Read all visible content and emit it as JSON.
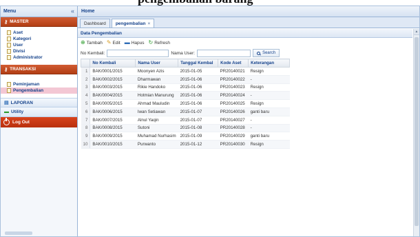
{
  "caption": "pengembalian barang",
  "sidebar": {
    "title": "Menu",
    "collapse_glyph": "«",
    "master": {
      "label": "MASTER",
      "icon": "key-icon"
    },
    "master_items": [
      {
        "label": "Aset"
      },
      {
        "label": "Kategori"
      },
      {
        "label": "User"
      },
      {
        "label": "Divisi"
      },
      {
        "label": "Administrator"
      }
    ],
    "transaksi": {
      "label": "TRANSAKSI",
      "icon": "key-icon"
    },
    "transaksi_items": [
      {
        "label": "Peminjaman"
      },
      {
        "label": "Pengembalian",
        "selected": true
      }
    ],
    "laporan": {
      "label": "LAPORAN"
    },
    "utility": {
      "label": "Utility"
    },
    "logout": {
      "label": "Log Out"
    }
  },
  "main": {
    "title": "Home",
    "tabs": [
      {
        "label": "Dashboard",
        "active": false
      },
      {
        "label": "pengembalian",
        "active": true,
        "close": "×"
      }
    ],
    "grid_title": "Data Pengembalian",
    "toolbar": {
      "add": "Tambah",
      "edit": "Edit",
      "delete": "Hapus",
      "refresh": "Refresh"
    },
    "search": {
      "no_kembali_label": "No Kembali:",
      "no_kembali_value": "",
      "nama_user_label": "Nama User:",
      "nama_user_value": "",
      "button": "Search"
    },
    "columns": [
      "No Kembali",
      "Nama User",
      "Tanggal Kembal",
      "Kode Aset",
      "Keterangan"
    ],
    "rows": [
      {
        "no": "1",
        "no_kembali": "BAK/0001/2015",
        "nama_user": "Moonyen Azis",
        "tanggal": "2015-01-05",
        "kode_aset": "PR20140021",
        "keterangan": "Resign"
      },
      {
        "no": "2",
        "no_kembali": "BAK/0002/2015",
        "nama_user": "Dharmawan",
        "tanggal": "2015-01-06",
        "kode_aset": "PR20140022",
        "keterangan": "-"
      },
      {
        "no": "3",
        "no_kembali": "BAK/0003/2015",
        "nama_user": "Rikie Handoko",
        "tanggal": "2015-01-06",
        "kode_aset": "PR20140023",
        "keterangan": "Resign"
      },
      {
        "no": "4",
        "no_kembali": "BAK/0004/2015",
        "nama_user": "Hotmian Manurung",
        "tanggal": "2015-01-06",
        "kode_aset": "PR20140024",
        "keterangan": "-"
      },
      {
        "no": "5",
        "no_kembali": "BAK/0005/2015",
        "nama_user": "Ahmad Mauludin",
        "tanggal": "2015-01-06",
        "kode_aset": "PR20140025",
        "keterangan": "Resign"
      },
      {
        "no": "6",
        "no_kembali": "BAK/0006/2015",
        "nama_user": "Iwan Setiawan",
        "tanggal": "2015-01-07",
        "kode_aset": "PR20140026",
        "keterangan": "ganti baru"
      },
      {
        "no": "7",
        "no_kembali": "BAK/0007/2015",
        "nama_user": "Alnul Yaqin",
        "tanggal": "2015-01-07",
        "kode_aset": "PR20140027",
        "keterangan": "-"
      },
      {
        "no": "8",
        "no_kembali": "BAK/0008/2015",
        "nama_user": "Sutoni",
        "tanggal": "2015-01-08",
        "kode_aset": "PR20140028",
        "keterangan": "-"
      },
      {
        "no": "9",
        "no_kembali": "BAK/0009/2015",
        "nama_user": "Muhamad Nurhasim",
        "tanggal": "2015-01-09",
        "kode_aset": "PR20140029",
        "keterangan": "ganti baru"
      },
      {
        "no": "10",
        "no_kembali": "BAK/0010/2015",
        "nama_user": "Purwanto",
        "tanggal": "2015-01-12",
        "kode_aset": "PR20140030",
        "keterangan": "Resign"
      }
    ]
  }
}
